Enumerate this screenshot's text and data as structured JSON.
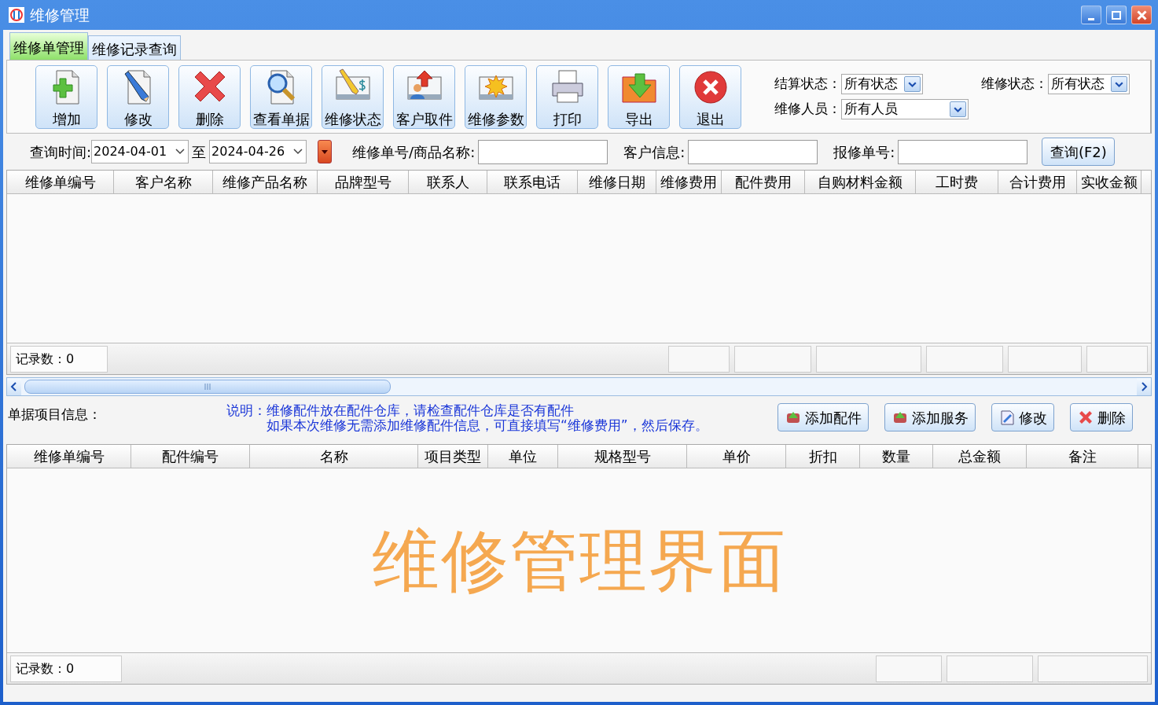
{
  "window": {
    "title": "维修管理"
  },
  "tabs": [
    {
      "label": "维修单管理",
      "selected": true
    },
    {
      "label": "维修记录查询",
      "selected": false
    }
  ],
  "toolbar": [
    {
      "label": "增加",
      "kind": "add"
    },
    {
      "label": "修改",
      "kind": "edit"
    },
    {
      "label": "删除",
      "kind": "delete"
    },
    {
      "label": "查看单据",
      "kind": "view"
    },
    {
      "label": "维修状态",
      "kind": "status"
    },
    {
      "label": "客户取件",
      "kind": "pickup"
    },
    {
      "label": "维修参数",
      "kind": "params"
    },
    {
      "label": "打印",
      "kind": "print"
    },
    {
      "label": "导出",
      "kind": "export"
    },
    {
      "label": "退出",
      "kind": "exit"
    }
  ],
  "filters": [
    {
      "label": "结算状态：",
      "value": "所有状态"
    },
    {
      "label": "维修状态：",
      "value": "所有状态"
    },
    {
      "label": "维修人员：",
      "value": "所有人员"
    }
  ],
  "search": {
    "date_label": "查询时间:",
    "date_from": "2024-04-01",
    "date_separator": "至",
    "date_to": "2024-04-26",
    "fields": [
      {
        "label": "维修单号/商品名称:"
      },
      {
        "label": "客户信息:"
      },
      {
        "label": "报修单号:"
      }
    ],
    "button": "查询(F2)"
  },
  "orders_table": {
    "columns": [
      "维修单编号",
      "客户名称",
      "维修产品名称",
      "品牌型号",
      "联系人",
      "联系电话",
      "维修日期",
      "维修费用",
      "配件费用",
      "自购材料金额",
      "工时费",
      "合计费用",
      "实收金额"
    ],
    "record_count": "记录数：0"
  },
  "details": {
    "label": "单据项目信息：",
    "note_label": "说明：",
    "note_lines": [
      "维修配件放在配件仓库，请检查配件仓库是否有配件",
      "如果本次维修无需添加维修配件信息，可直接填写“维修费用”，然后保存。"
    ],
    "buttons": [
      {
        "label": "添加配件",
        "kind": "add_part"
      },
      {
        "label": "添加服务",
        "kind": "add_service"
      },
      {
        "label": "修改",
        "kind": "edit"
      },
      {
        "label": "删除",
        "kind": "delete"
      }
    ]
  },
  "items_table": {
    "columns": [
      "维修单编号",
      "配件编号",
      "名称",
      "项目类型",
      "单位",
      "规格型号",
      "单价",
      "折扣",
      "数量",
      "总金额",
      "备注"
    ],
    "record_count": "记录数：0"
  },
  "caption": "维修管理界面"
}
